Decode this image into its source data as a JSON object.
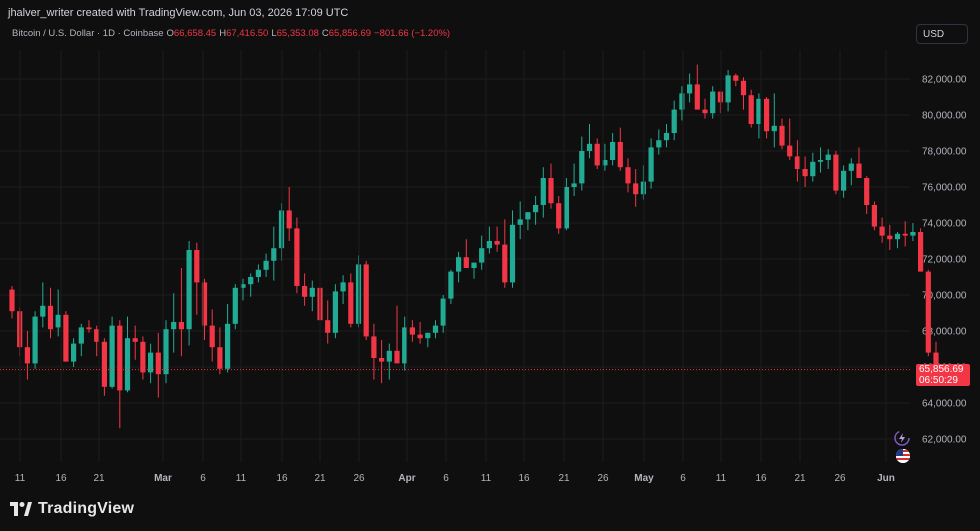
{
  "header": {
    "attribution": "jhalver_writer created with TradingView.com, Jun 03, 2026 17:09 UTC"
  },
  "legend": {
    "symbol": "Bitcoin / U.S. Dollar · 1D · Coinbase",
    "open_label": "O",
    "open_value": "66,658.45",
    "high_label": "H",
    "high_value": "67,416.50",
    "low_label": "L",
    "low_value": "65,353.08",
    "close_label": "C",
    "close_value": "65,856.69",
    "change": "−801.66 (−1.20%)"
  },
  "currency_button": "USD",
  "price_badge": {
    "price": "65,856.69",
    "countdown": "06:50:29"
  },
  "footer": {
    "brand": "TradingView"
  },
  "colors": {
    "up": "#22ab94",
    "down": "#f23645",
    "background": "#0f0f0f",
    "grid": "#1c1c1c"
  },
  "icons": [
    "lightning-icon",
    "us-flag-icon",
    "tradingview-logo-icon"
  ],
  "chart_data": {
    "type": "candlestick",
    "y_ticks": [
      "82,000.00",
      "80,000.00",
      "78,000.00",
      "76,000.00",
      "74,000.00",
      "72,000.00",
      "70,000.00",
      "68,000.00",
      "66,000.00",
      "64,000.00",
      "62,000.00"
    ],
    "x_ticks": [
      "11",
      "16",
      "21",
      "Mar",
      "6",
      "11",
      "16",
      "21",
      "26",
      "Apr",
      "6",
      "11",
      "16",
      "21",
      "26",
      "May",
      "6",
      "11",
      "16",
      "21",
      "26",
      "Jun"
    ],
    "ylim": [
      61000,
      84000
    ],
    "last_price": 65856.69,
    "candles": [
      [
        70300,
        70500,
        68700,
        69100
      ],
      [
        69100,
        69300,
        66600,
        67100
      ],
      [
        67100,
        68000,
        65300,
        66200
      ],
      [
        66200,
        69100,
        65900,
        68800
      ],
      [
        68800,
        70700,
        68200,
        69400
      ],
      [
        69400,
        70400,
        67600,
        68100
      ],
      [
        68200,
        70300,
        67700,
        68900
      ],
      [
        68900,
        69100,
        67000,
        66300
      ],
      [
        66300,
        67600,
        66000,
        67300
      ],
      [
        67300,
        68400,
        66600,
        68200
      ],
      [
        68200,
        68600,
        67900,
        68100
      ],
      [
        68100,
        68300,
        66600,
        67400
      ],
      [
        67400,
        67600,
        64400,
        64900
      ],
      [
        64900,
        68800,
        64800,
        68300
      ],
      [
        68300,
        68600,
        62600,
        64700
      ],
      [
        64700,
        68800,
        64600,
        67600
      ],
      [
        67600,
        68300,
        66400,
        67400
      ],
      [
        67400,
        67700,
        65300,
        65700
      ],
      [
        65700,
        67300,
        65100,
        66800
      ],
      [
        66800,
        67900,
        64300,
        65600
      ],
      [
        65600,
        68600,
        65100,
        68100
      ],
      [
        68100,
        70100,
        66800,
        68500
      ],
      [
        68500,
        71500,
        66600,
        68100
      ],
      [
        68100,
        73000,
        67200,
        72500
      ],
      [
        72500,
        72900,
        68900,
        70700
      ],
      [
        70700,
        70900,
        67500,
        68300
      ],
      [
        68300,
        69200,
        66300,
        67100
      ],
      [
        67100,
        68200,
        65600,
        65900
      ],
      [
        65900,
        69500,
        65700,
        68400
      ],
      [
        68400,
        70600,
        68100,
        70400
      ],
      [
        70400,
        70900,
        69700,
        70600
      ],
      [
        70600,
        71200,
        69900,
        71000
      ],
      [
        71000,
        71700,
        70700,
        71400
      ],
      [
        71400,
        72300,
        71000,
        71900
      ],
      [
        71900,
        73800,
        70800,
        72600
      ],
      [
        72600,
        75100,
        71900,
        74700
      ],
      [
        74700,
        76000,
        73000,
        73700
      ],
      [
        73700,
        74300,
        70100,
        70500
      ],
      [
        70500,
        71200,
        69400,
        69900
      ],
      [
        69900,
        70800,
        69100,
        70400
      ],
      [
        70400,
        70800,
        68300,
        68600
      ],
      [
        68600,
        69700,
        67300,
        67900
      ],
      [
        67900,
        70600,
        67600,
        70200
      ],
      [
        70200,
        71100,
        69500,
        70700
      ],
      [
        70700,
        71200,
        68200,
        68400
      ],
      [
        68400,
        72200,
        68200,
        71700
      ],
      [
        71700,
        71900,
        67500,
        67700
      ],
      [
        67700,
        68400,
        65300,
        66500
      ],
      [
        66500,
        67500,
        65100,
        66300
      ],
      [
        66300,
        67300,
        65300,
        66900
      ],
      [
        66900,
        69400,
        66600,
        66200
      ],
      [
        66200,
        68800,
        65800,
        68200
      ],
      [
        68200,
        68600,
        67400,
        67800
      ],
      [
        67800,
        68500,
        67300,
        67600
      ],
      [
        67600,
        67900,
        67100,
        67900
      ],
      [
        67900,
        68600,
        67600,
        68300
      ],
      [
        68300,
        70000,
        67900,
        69800
      ],
      [
        69800,
        71400,
        69500,
        71300
      ],
      [
        71300,
        72400,
        70700,
        72100
      ],
      [
        72100,
        73100,
        71700,
        71500
      ],
      [
        71500,
        71800,
        70900,
        71800
      ],
      [
        71800,
        73300,
        71400,
        72600
      ],
      [
        72600,
        73800,
        72300,
        73000
      ],
      [
        73000,
        73800,
        72400,
        72800
      ],
      [
        72800,
        74200,
        70400,
        70700
      ],
      [
        70700,
        74700,
        70400,
        73900
      ],
      [
        73900,
        75200,
        73100,
        74200
      ],
      [
        74200,
        74600,
        73600,
        74600
      ],
      [
        74600,
        75500,
        73900,
        75000
      ],
      [
        75000,
        77100,
        74300,
        76500
      ],
      [
        76500,
        77300,
        74800,
        75100
      ],
      [
        75100,
        75500,
        73400,
        73700
      ],
      [
        73700,
        76500,
        73600,
        76000
      ],
      [
        76000,
        77300,
        75500,
        76200
      ],
      [
        76200,
        78800,
        75800,
        78000
      ],
      [
        78000,
        79500,
        77600,
        78400
      ],
      [
        78400,
        78700,
        77000,
        77200
      ],
      [
        77200,
        78400,
        76900,
        77500
      ],
      [
        77500,
        79000,
        77200,
        78500
      ],
      [
        78500,
        79300,
        76900,
        77100
      ],
      [
        77100,
        77600,
        75700,
        76200
      ],
      [
        76200,
        77000,
        74900,
        75600
      ],
      [
        75600,
        77200,
        75300,
        76300
      ],
      [
        76300,
        78700,
        75900,
        78200
      ],
      [
        78200,
        79200,
        77800,
        78600
      ],
      [
        78600,
        79500,
        78200,
        79000
      ],
      [
        79000,
        80800,
        78600,
        80300
      ],
      [
        80300,
        81600,
        79700,
        81200
      ],
      [
        81200,
        82300,
        80700,
        81700
      ],
      [
        81700,
        82800,
        80300,
        80300
      ],
      [
        80300,
        80900,
        79800,
        80100
      ],
      [
        80100,
        81600,
        79800,
        81300
      ],
      [
        81300,
        81300,
        80100,
        80700
      ],
      [
        80700,
        82500,
        80200,
        82200
      ],
      [
        82200,
        82300,
        81600,
        81900
      ],
      [
        81900,
        82100,
        80300,
        81100
      ],
      [
        81100,
        81400,
        79300,
        79500
      ],
      [
        79500,
        81200,
        78700,
        80900
      ],
      [
        80900,
        81000,
        78700,
        79100
      ],
      [
        79100,
        81200,
        78200,
        79400
      ],
      [
        79400,
        79800,
        78100,
        78300
      ],
      [
        78300,
        79800,
        77500,
        77700
      ],
      [
        77700,
        78600,
        76300,
        77000
      ],
      [
        77000,
        77700,
        76000,
        76600
      ],
      [
        76600,
        77900,
        76300,
        77400
      ],
      [
        77400,
        78200,
        76800,
        77500
      ],
      [
        77500,
        78100,
        77000,
        77800
      ],
      [
        77800,
        78000,
        75600,
        75800
      ],
      [
        75800,
        77200,
        75400,
        76900
      ],
      [
        76900,
        77600,
        76100,
        77300
      ],
      [
        77300,
        78200,
        76800,
        76500
      ],
      [
        76500,
        76600,
        74500,
        75000
      ],
      [
        75000,
        75200,
        73600,
        73800
      ],
      [
        73800,
        74300,
        72900,
        73300
      ],
      [
        73300,
        73900,
        72500,
        73100
      ],
      [
        73100,
        73500,
        72600,
        73400
      ],
      [
        73400,
        74100,
        72700,
        73300
      ],
      [
        73300,
        74000,
        73000,
        73500
      ],
      [
        73500,
        73700,
        71300,
        71300
      ],
      [
        71300,
        71400,
        66600,
        66800
      ],
      [
        66800,
        67400,
        65400,
        65900
      ]
    ]
  }
}
